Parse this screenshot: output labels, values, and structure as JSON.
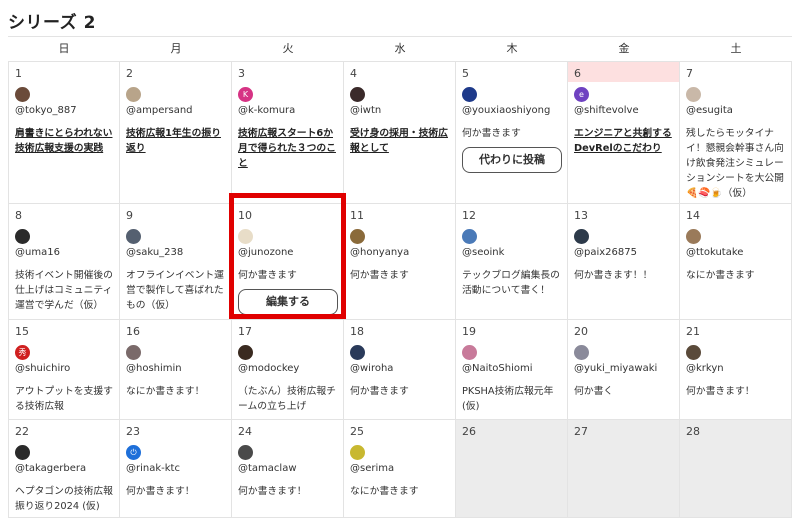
{
  "title": "シリーズ 2",
  "weekdays": [
    "日",
    "月",
    "火",
    "水",
    "木",
    "金",
    "土"
  ],
  "colors": {
    "today": "#fde0e0",
    "empty": "#ececec",
    "highlight": "#e00000"
  },
  "days": [
    {
      "num": "1",
      "user": "@tokyo_887",
      "link": "肩書きにとらわれない技術広報支援の実践",
      "avatar": "#6b4b3a"
    },
    {
      "num": "2",
      "user": "@ampersand",
      "link": "技術広報1年生の振り返り",
      "avatar": "#b8a48a"
    },
    {
      "num": "3",
      "user": "@k-komura",
      "link": "技術広報スタート6か月で得られた３つのこと",
      "avatar": "#d63384",
      "avatar_text": "K"
    },
    {
      "num": "4",
      "user": "@iwtn",
      "link": "受け身の採用・技術広報として",
      "avatar": "#3a2a2a"
    },
    {
      "num": "5",
      "user": "@youxiaoshiyong",
      "text": "何か書きます",
      "button": "代わりに投稿",
      "avatar": "#1e3a8a"
    },
    {
      "num": "6",
      "user": "@shiftevolve",
      "link": "エンジニアと共創するDevRelのこだわり",
      "avatar": "#6f42c1",
      "avatar_text": "e"
    },
    {
      "num": "7",
      "user": "@esugita",
      "text": "残したらモッタイナイ！懇親会幹事さん向け飲食発注シミュレーションシートを大公開🍕🍣🍺（仮）",
      "avatar": "#c9b8a8"
    },
    {
      "num": "8",
      "user": "@uma16",
      "text": "技術イベント開催後の仕上げはコミュニティ運営で学んだ（仮）",
      "avatar": "#2b2b2b"
    },
    {
      "num": "9",
      "user": "@saku_238",
      "text": "オフラインイベント運営で製作して喜ばれたもの（仮）",
      "avatar": "#556070"
    },
    {
      "num": "10",
      "user": "@junozone",
      "text": "何か書きます",
      "button": "編集する",
      "avatar": "#e8ddc8"
    },
    {
      "num": "11",
      "user": "@honyanya",
      "text": "何か書きます",
      "avatar": "#8a6a3a"
    },
    {
      "num": "12",
      "user": "@seoink",
      "text": "テックブログ編集長の活動について書く！",
      "avatar": "#4a7ab8"
    },
    {
      "num": "13",
      "user": "@paix26875",
      "text": "何か書きます！！",
      "avatar": "#2d3a4a"
    },
    {
      "num": "14",
      "user": "@ttokutake",
      "text": "なにか書きます",
      "avatar": "#9a7a5a"
    },
    {
      "num": "15",
      "user": "@shuichiro",
      "text": "アウトプットを支援する技術広報",
      "avatar": "#d02020",
      "avatar_text": "秀"
    },
    {
      "num": "16",
      "user": "@hoshimin",
      "text": "なにか書きます！",
      "avatar": "#7a6a6a"
    },
    {
      "num": "17",
      "user": "@modockey",
      "text": "（たぶん）技術広報チームの立ち上げ",
      "avatar": "#3a2a20"
    },
    {
      "num": "18",
      "user": "@wiroha",
      "text": "何か書きます",
      "avatar": "#2a3a5a"
    },
    {
      "num": "19",
      "user": "@NaitoShiomi",
      "text": "PKSHA技術広報元年(仮)",
      "avatar": "#c87a9a"
    },
    {
      "num": "20",
      "user": "@yuki_miyawaki",
      "text": "何か書く",
      "avatar": "#8a8a9a"
    },
    {
      "num": "21",
      "user": "@krkyn",
      "text": "何か書きます！",
      "avatar": "#5a4a3a"
    },
    {
      "num": "22",
      "user": "@takagerbera",
      "text": "ヘプタゴンの技術広報振り返り2024 (仮)",
      "avatar": "#2a2a2a"
    },
    {
      "num": "23",
      "user": "@rinak-ktc",
      "text": "何か書きます！",
      "avatar": "#1e6fd9",
      "avatar_text": "⏻"
    },
    {
      "num": "24",
      "user": "@tamaclaw",
      "text": "何か書きます！",
      "avatar": "#4a4a4a"
    },
    {
      "num": "25",
      "user": "@serima",
      "text": "なにか書きます",
      "avatar": "#c8b830"
    },
    {
      "num": "26",
      "empty": true
    },
    {
      "num": "27",
      "empty": true
    },
    {
      "num": "28",
      "empty": true
    }
  ]
}
